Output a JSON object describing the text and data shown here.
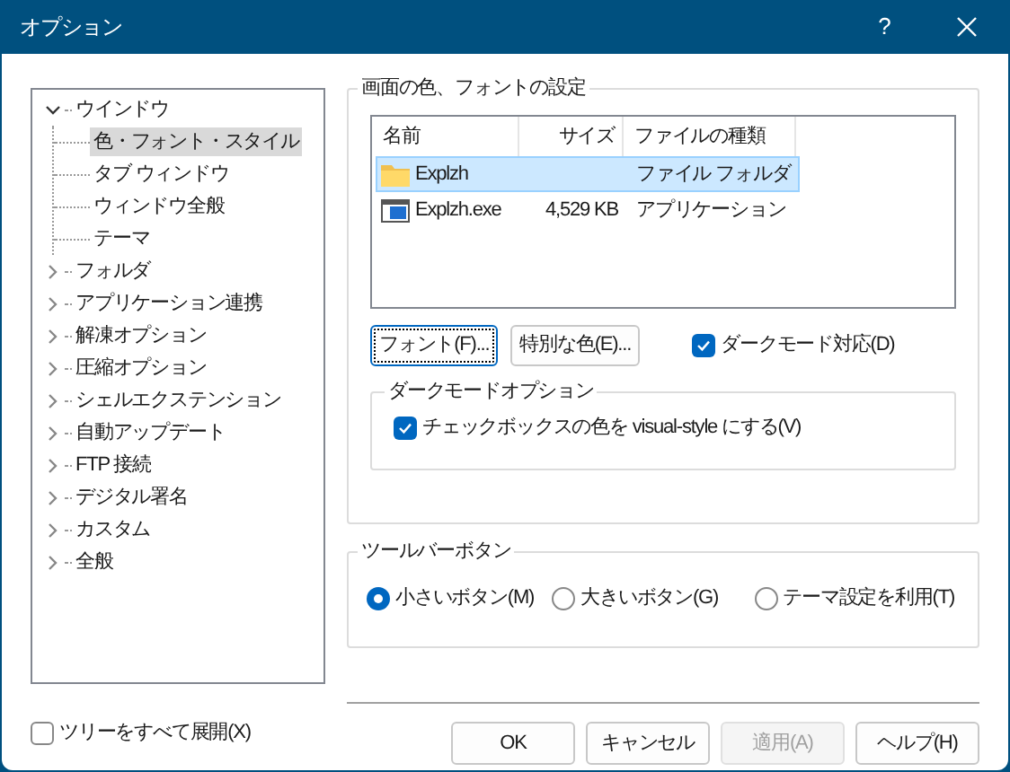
{
  "window": {
    "title": "オプション",
    "help": "?"
  },
  "tree": [
    {
      "label": "ウインドウ",
      "expanded": true,
      "selected": false,
      "children": [
        {
          "label": "色・フォント・スタイル",
          "selected": true
        },
        {
          "label": "タブ ウィンドウ",
          "selected": false
        },
        {
          "label": "ウィンドウ全般",
          "selected": false
        },
        {
          "label": "テーマ",
          "selected": false
        }
      ]
    },
    {
      "label": "フォルダ",
      "expanded": false,
      "selected": false
    },
    {
      "label": "アプリケーション連携",
      "expanded": false,
      "selected": false
    },
    {
      "label": "解凍オプション",
      "expanded": false,
      "selected": false
    },
    {
      "label": "圧縮オプション",
      "expanded": false,
      "selected": false
    },
    {
      "label": "シェルエクステンション",
      "expanded": false,
      "selected": false
    },
    {
      "label": "自動アップデート",
      "expanded": false,
      "selected": false
    },
    {
      "label": "FTP 接続",
      "expanded": false,
      "selected": false
    },
    {
      "label": "デジタル署名",
      "expanded": false,
      "selected": false
    },
    {
      "label": "カスタム",
      "expanded": false,
      "selected": false
    },
    {
      "label": "全般",
      "expanded": false,
      "selected": false
    }
  ],
  "expand_all": {
    "label": "ツリーをすべて展開(X)",
    "checked": false
  },
  "color_font_group": {
    "title": "画面の色、フォントの設定",
    "list": {
      "columns": [
        "名前",
        "サイズ",
        "ファイルの種類"
      ],
      "rows": [
        {
          "kind": "folder",
          "name": "Explzh",
          "size": "",
          "type": "ファイル フォルダ",
          "selected": true
        },
        {
          "kind": "exe",
          "name": "Explzh.exe",
          "size": "4,529 KB",
          "type": "アプリケーション",
          "selected": false
        }
      ]
    },
    "buttons": [
      "フォント(F)...",
      "特別な色(E)..."
    ],
    "dark_mode": {
      "label": "ダークモード対応(D)",
      "checked": true
    },
    "dark_options": {
      "title": "ダークモードオプション",
      "checkbox": {
        "label": "チェックボックスの色を visual-style にする(V)",
        "checked": true
      }
    }
  },
  "toolbar_group": {
    "title": "ツールバーボタン",
    "options": [
      {
        "label": "小さいボタン(M)",
        "selected": true
      },
      {
        "label": "大きいボタン(G)",
        "selected": false
      },
      {
        "label": "テーマ設定を利用(T)",
        "selected": false
      }
    ]
  },
  "buttons": [
    {
      "label": "OK",
      "disabled": false
    },
    {
      "label": "キャンセル",
      "disabled": false
    },
    {
      "label": "適用(A)",
      "disabled": true
    },
    {
      "label": "ヘルプ(H)",
      "disabled": false
    }
  ]
}
